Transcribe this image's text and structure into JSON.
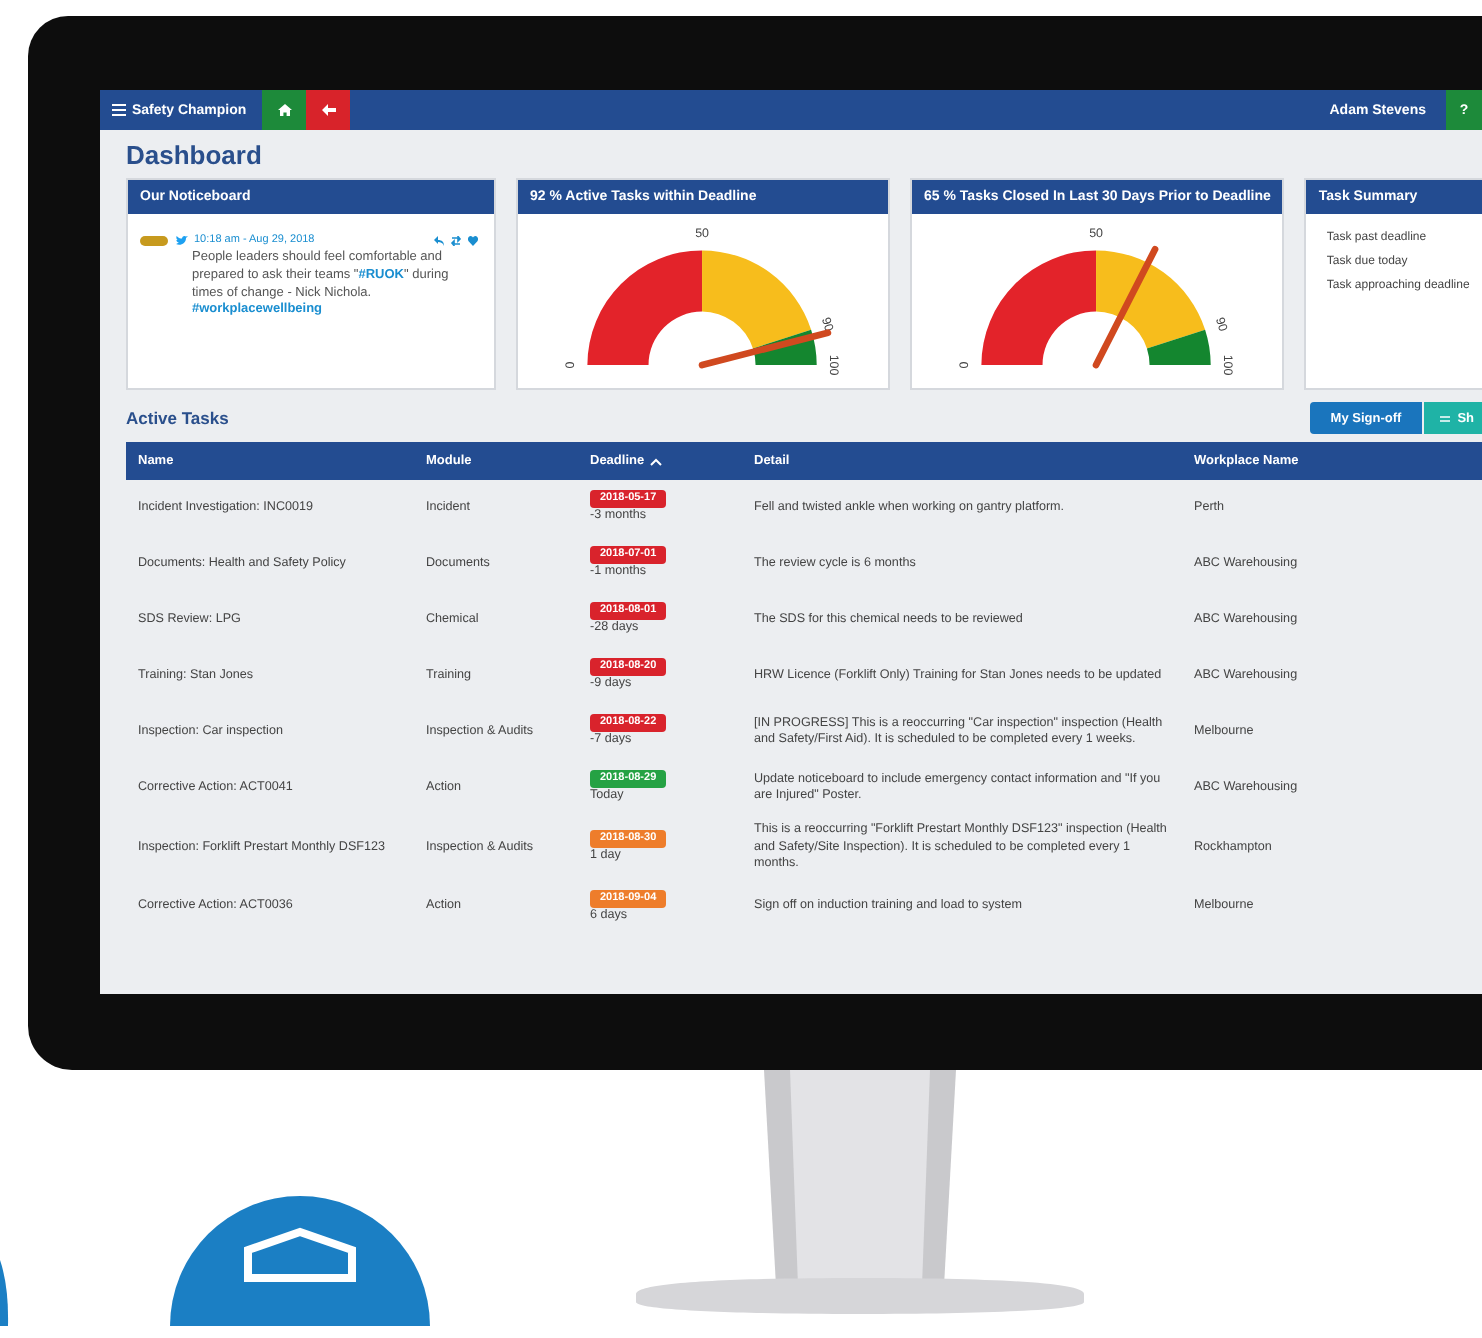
{
  "topbar": {
    "menu_label": "Safety Champion",
    "user": "Adam Stevens",
    "help": "?"
  },
  "page_title": "Dashboard",
  "noticeboard": {
    "title": "Our Noticeboard",
    "tweet": {
      "time": "10:18 am - Aug 29, 2018",
      "parts": [
        {
          "text": "People leaders should feel comfortable and prepared to ask their teams \"",
          "link": false
        },
        {
          "text": "#RUOK",
          "link": true
        },
        {
          "text": "\" during times of change - Nick Nichola. ",
          "link": false
        },
        {
          "text": "#workplacewellbeing",
          "link": true
        }
      ]
    }
  },
  "gauges": [
    {
      "value": "92 %",
      "title": "Active Tasks within Deadline",
      "ticks": [
        "0",
        "50",
        "90",
        "100"
      ],
      "bands": [
        {
          "color": "#e3232a"
        },
        {
          "color": "#f7bd1c"
        },
        {
          "color": "#14862f"
        }
      ]
    },
    {
      "value": "65 %",
      "title": "Tasks Closed In Last 30 Days Prior to Deadline",
      "ticks": [
        "0",
        "50",
        "90",
        "100"
      ],
      "bands": [
        {
          "color": "#e3232a"
        },
        {
          "color": "#f7bd1c"
        },
        {
          "color": "#14862f"
        }
      ]
    }
  ],
  "task_summary": {
    "title": "Task Summary",
    "items": [
      "Task past deadline",
      "Task due today",
      "Task approaching deadline"
    ]
  },
  "active_tasks": {
    "title": "Active Tasks",
    "buttons": [
      {
        "label": "My Sign-off",
        "kind": "primary"
      },
      {
        "label": "Sh",
        "kind": "toggle"
      }
    ],
    "columns": [
      {
        "label": "Name"
      },
      {
        "label": "Module"
      },
      {
        "label": "Deadline",
        "sorted": true
      },
      {
        "label": "Detail"
      },
      {
        "label": "Workplace Name"
      }
    ],
    "rows": [
      {
        "name": "Incident Investigation: INC0019",
        "module": "Incident",
        "date": "2018-05-17",
        "relative": "-3 months",
        "color": "#d9232c",
        "detail": "Fell and twisted ankle when working on gantry platform.",
        "workplace": "Perth"
      },
      {
        "name": "Documents: Health and Safety Policy",
        "module": "Documents",
        "date": "2018-07-01",
        "relative": "-1 months",
        "color": "#d9232c",
        "detail": "The review cycle is 6 months",
        "workplace": "ABC Warehousing"
      },
      {
        "name": "SDS Review: LPG",
        "module": "Chemical",
        "date": "2018-08-01",
        "relative": "-28 days",
        "color": "#d9232c",
        "detail": "The SDS for this chemical needs to be reviewed",
        "workplace": "ABC Warehousing"
      },
      {
        "name": "Training: Stan Jones",
        "module": "Training",
        "date": "2018-08-20",
        "relative": "-9 days",
        "color": "#d9232c",
        "detail": "HRW Licence (Forklift Only) Training for Stan Jones needs to be updated",
        "workplace": "ABC Warehousing"
      },
      {
        "name": "Inspection: Car inspection",
        "module": "Inspection & Audits",
        "date": "2018-08-22",
        "relative": "-7 days",
        "color": "#d9232c",
        "detail": "[IN PROGRESS] This is a reoccurring \"Car inspection\" inspection (Health and Safety/First Aid). It is scheduled to be completed every 1 weeks.",
        "workplace": "Melbourne"
      },
      {
        "name": "Corrective Action: ACT0041",
        "module": "Action",
        "date": "2018-08-29",
        "relative": "Today",
        "color": "#25a244",
        "detail": "Update noticeboard to include emergency contact information and \"If you are Injured\" Poster.",
        "workplace": "ABC Warehousing"
      },
      {
        "name": "Inspection: Forklift Prestart Monthly DSF123",
        "module": "Inspection & Audits",
        "date": "2018-08-30",
        "relative": "1 day",
        "color": "#ee7d2b",
        "detail": "This is a reoccurring \"Forklift Prestart Monthly DSF123\" inspection (Health and Safety/Site Inspection). It is scheduled to be completed every 1 months.",
        "workplace": "Rockhampton"
      },
      {
        "name": "Corrective Action: ACT0036",
        "module": "Action",
        "date": "2018-09-04",
        "relative": "6 days",
        "color": "#ee7d2b",
        "detail": "Sign off on induction training and load to system",
        "workplace": "Melbourne"
      }
    ]
  }
}
